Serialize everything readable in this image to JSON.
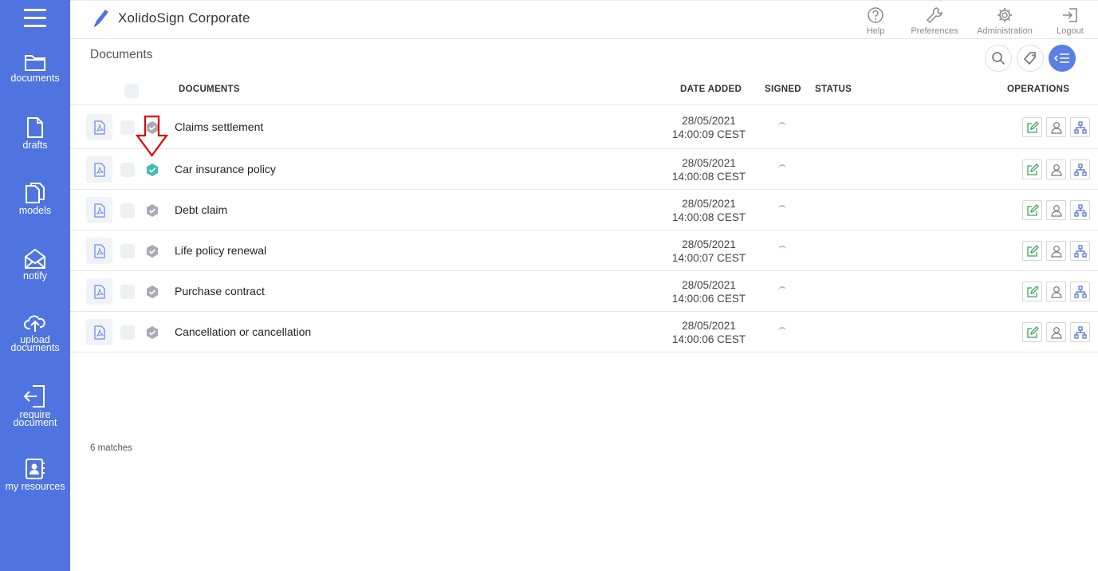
{
  "app": {
    "title": "XolidoSign Corporate"
  },
  "sidebar": {
    "items": [
      {
        "label": "documents",
        "icon": "folder-icon"
      },
      {
        "label": "drafts",
        "icon": "file-icon"
      },
      {
        "label": "models",
        "icon": "files-icon"
      },
      {
        "label": "notify",
        "icon": "envelope-icon"
      },
      {
        "label": "upload\ndocuments",
        "icon": "cloud-upload-icon"
      },
      {
        "label": "require\ndocument",
        "icon": "sign-in-icon"
      },
      {
        "label": "my resources",
        "icon": "contact-book-icon"
      }
    ]
  },
  "header": {
    "actions": [
      {
        "label": "Help",
        "icon": "help-icon"
      },
      {
        "label": "Preferences",
        "icon": "wrench-icon"
      },
      {
        "label": "Administration",
        "icon": "gear-icon"
      },
      {
        "label": "Logout",
        "icon": "logout-icon"
      }
    ]
  },
  "main": {
    "title": "Documents",
    "columns": {
      "documents": "DOCUMENTS",
      "date_added": "DATE ADDED",
      "signed": "SIGNED",
      "status": "STATUS",
      "operations": "OPERATIONS"
    },
    "rows": [
      {
        "name": "Claims settlement",
        "date": "28/05/2021",
        "time": "14:00:09 CEST",
        "verified": false
      },
      {
        "name": "Car insurance policy",
        "date": "28/05/2021",
        "time": "14:00:08 CEST",
        "verified": true
      },
      {
        "name": "Debt claim",
        "date": "28/05/2021",
        "time": "14:00:08 CEST",
        "verified": false
      },
      {
        "name": "Life policy renewal",
        "date": "28/05/2021",
        "time": "14:00:07 CEST",
        "verified": false
      },
      {
        "name": "Purchase contract",
        "date": "28/05/2021",
        "time": "14:00:06 CEST",
        "verified": false
      },
      {
        "name": "Cancellation or cancellation",
        "date": "28/05/2021",
        "time": "14:00:06 CEST",
        "verified": false
      }
    ],
    "match_count": "6 matches"
  },
  "colors": {
    "sidebar": "#4f74e0",
    "accent": "#5b80e4",
    "verified_shield": "#3dbfb0",
    "default_shield": "#a8abb6",
    "edit_green": "#3aa55c",
    "annotation": "#e00000"
  }
}
